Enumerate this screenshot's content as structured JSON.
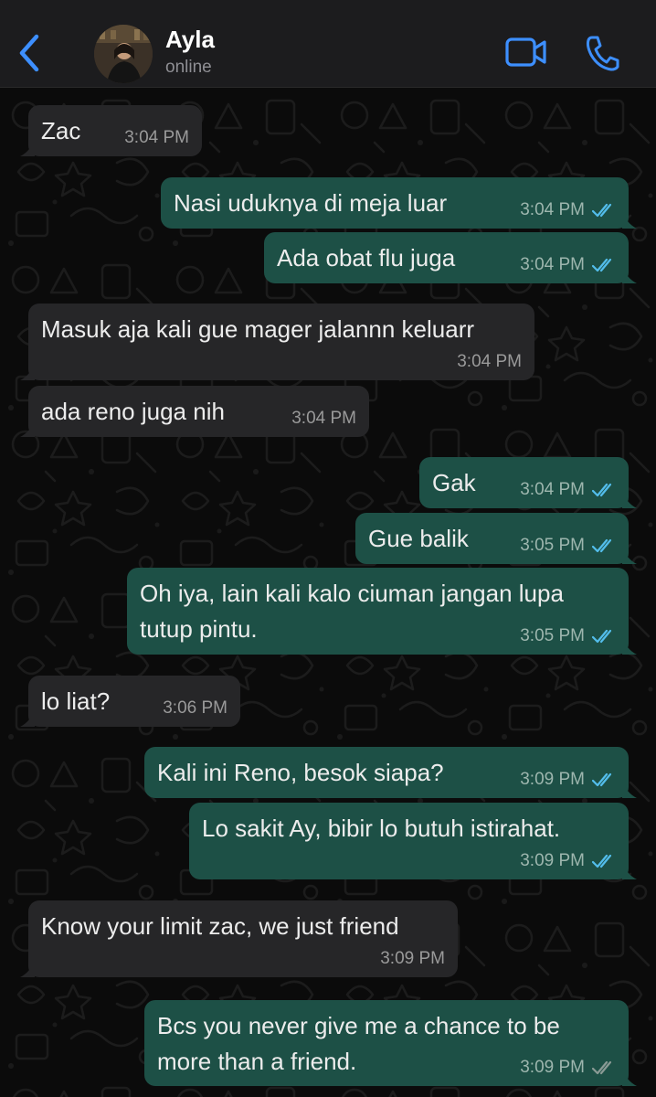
{
  "header": {
    "contact_name": "Ayla",
    "contact_status": "online",
    "icons": [
      "chevron-left-icon",
      "video-call-icon",
      "phone-icon"
    ]
  },
  "colors": {
    "accent": "#3d8fff",
    "incoming_bubble": "#262628",
    "outgoing_bubble": "#1d5046",
    "read_ticks": "#53bdeb",
    "delivered_ticks": "#8a9a95"
  },
  "messages": [
    {
      "direction": "in",
      "text": "Zac",
      "time": "3:04 PM"
    },
    {
      "direction": "out",
      "text": "Nasi uduknya di meja luar",
      "time": "3:04 PM",
      "status": "read"
    },
    {
      "direction": "out",
      "text": "Ada obat flu juga",
      "time": "3:04 PM",
      "status": "read"
    },
    {
      "direction": "in",
      "text": "Masuk aja kali gue mager jalannn keluarr",
      "time": "3:04 PM"
    },
    {
      "direction": "in",
      "text": "ada reno juga nih",
      "time": "3:04 PM"
    },
    {
      "direction": "out",
      "text": "Gak",
      "time": "3:04 PM",
      "status": "read"
    },
    {
      "direction": "out",
      "text": "Gue balik",
      "time": "3:05 PM",
      "status": "read"
    },
    {
      "direction": "out",
      "text": "Oh iya, lain kali kalo ciuman jangan lupa\ntutup pintu.",
      "time": "3:05 PM",
      "status": "read"
    },
    {
      "direction": "in",
      "text": "lo liat?",
      "time": "3:06 PM"
    },
    {
      "direction": "out",
      "text": "Kali ini Reno, besok siapa?",
      "time": "3:09 PM",
      "status": "read"
    },
    {
      "direction": "out",
      "text": "Lo sakit Ay, bibir lo butuh istirahat.",
      "time": "3:09 PM",
      "status": "read"
    },
    {
      "direction": "in",
      "text": "Know your limit zac, we just friend",
      "time": "3:09 PM"
    },
    {
      "direction": "out",
      "text": "Bcs you never give me a chance to be\nmore than a friend.",
      "time": "3:09 PM",
      "status": "delivered"
    }
  ]
}
